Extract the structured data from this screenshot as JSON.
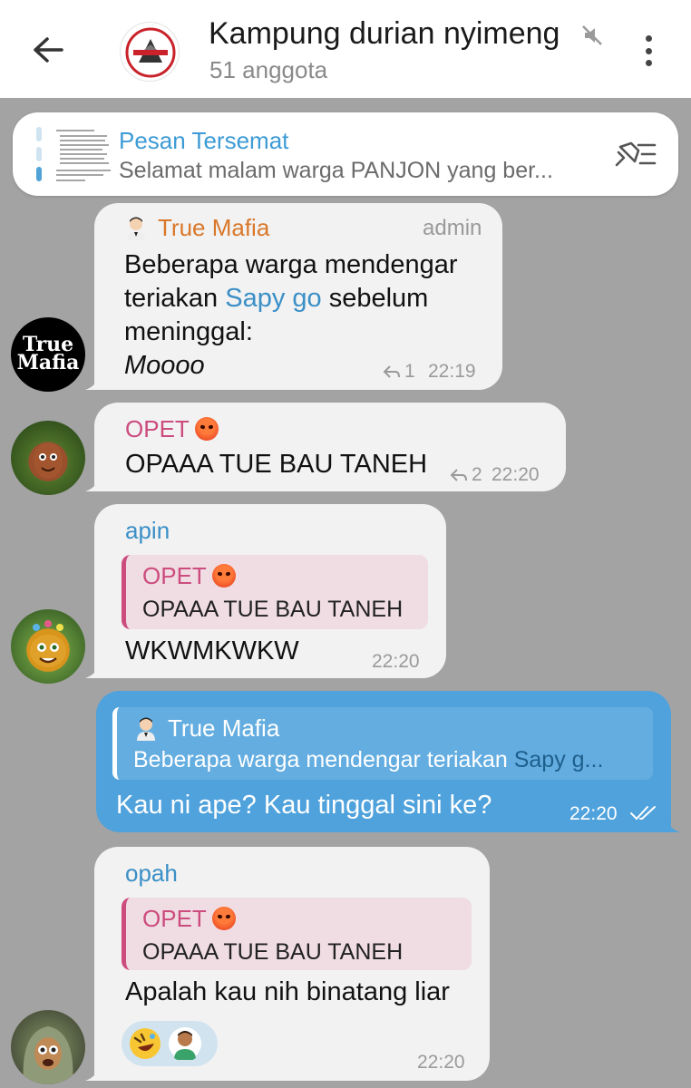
{
  "header": {
    "title": "Kampung durian nyimeng",
    "members": "51 anggota",
    "muted": true
  },
  "pinned": {
    "label": "Pesan Tersemat",
    "preview": "Selamat malam warga PANJON yang ber..."
  },
  "messages": [
    {
      "sender": "True Mafia",
      "role": "admin",
      "line1": "Beberapa warga mendengar",
      "line2_a": "teriakan ",
      "line2_link": "Sapy go",
      "line2_b": " sebelum",
      "line3": "meninggal:",
      "line4": "Moooo",
      "replies": "1",
      "time": "22:19"
    },
    {
      "sender": "OPET",
      "text": "OPAAA TUE BAU TANEH",
      "replies": "2",
      "time": "22:20"
    },
    {
      "sender": "apin",
      "quote_sender": "OPET",
      "quote_text": "OPAAA TUE BAU TANEH",
      "text": "WKWMKWKW",
      "time": "22:20"
    },
    {
      "sender": "You",
      "quote_sender": "True Mafia",
      "quote_text_a": "Beberapa warga mendengar teriakan ",
      "quote_text_link": "Sapy g...",
      "text": "Kau ni ape? Kau tinggal sini ke?",
      "time": "22:20",
      "status": "read"
    },
    {
      "sender": "opah",
      "quote_sender": "OPET",
      "quote_text": "OPAAA TUE BAU TANEH",
      "text": "Apalah kau nih binatang liar",
      "time": "22:20"
    }
  ],
  "avatars": {
    "truemafia_line1": "True",
    "truemafia_line2": "Mafia"
  },
  "colors": {
    "chat_bg": "#a3a3a3",
    "incoming": "#f2f2f2",
    "outgoing": "#4fa2dc",
    "true_mafia": "#d9782b",
    "opet": "#cc4c7e",
    "apin": "#3a8fc7",
    "opah": "#3a8fc7"
  }
}
